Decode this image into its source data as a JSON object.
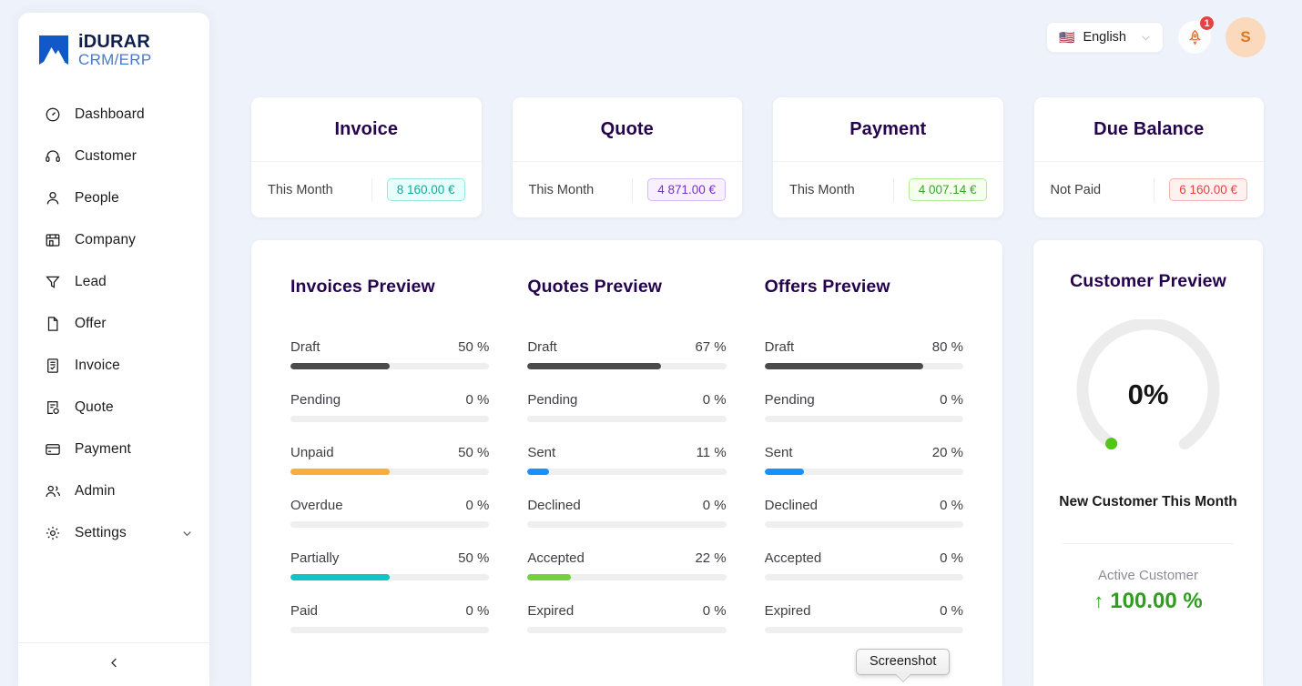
{
  "brand": {
    "name_line1": "iDURAR",
    "name_line2": "CRM/ERP",
    "logo_color": "#1158c9"
  },
  "sidebar": {
    "items": [
      {
        "label": "Dashboard",
        "icon": "dashboard-icon"
      },
      {
        "label": "Customer",
        "icon": "headset-icon"
      },
      {
        "label": "People",
        "icon": "person-icon"
      },
      {
        "label": "Company",
        "icon": "store-icon"
      },
      {
        "label": "Lead",
        "icon": "funnel-icon"
      },
      {
        "label": "Offer",
        "icon": "file-icon"
      },
      {
        "label": "Invoice",
        "icon": "invoice-icon"
      },
      {
        "label": "Quote",
        "icon": "quote-icon"
      },
      {
        "label": "Payment",
        "icon": "credit-card-icon"
      },
      {
        "label": "Admin",
        "icon": "admin-users-icon"
      },
      {
        "label": "Settings",
        "icon": "gear-icon",
        "has_caret": true
      }
    ],
    "collapse_icon": "chevron-left-icon"
  },
  "topbar": {
    "language": {
      "flag": "🇺🇸",
      "label": "English",
      "caret_icon": "chevron-down-icon"
    },
    "notification": {
      "icon": "rocket-icon",
      "badge": "1",
      "badge_color": "#e8423f"
    },
    "avatar": {
      "initial": "S",
      "bg": "#fbd9bc",
      "fg": "#e2751e"
    }
  },
  "stats": [
    {
      "title": "Invoice",
      "label": "This Month",
      "value": "8 160.00 €",
      "style": "pill-teal"
    },
    {
      "title": "Quote",
      "label": "This Month",
      "value": "4 871.00 €",
      "style": "pill-purple"
    },
    {
      "title": "Payment",
      "label": "This Month",
      "value": "4 007.14 €",
      "style": "pill-green"
    },
    {
      "title": "Due Balance",
      "label": "Not Paid",
      "value": "6 160.00 €",
      "style": "pill-red"
    }
  ],
  "previews": [
    {
      "title": "Invoices Preview",
      "rows": [
        {
          "name": "Draft",
          "pct": "50 %",
          "value": 50,
          "color": "#4b4b4b"
        },
        {
          "name": "Pending",
          "pct": "0 %",
          "value": 0,
          "color": "#4b4b4b"
        },
        {
          "name": "Unpaid",
          "pct": "50 %",
          "value": 50,
          "color": "#faad3f"
        },
        {
          "name": "Overdue",
          "pct": "0 %",
          "value": 0,
          "color": "#ff4d4f"
        },
        {
          "name": "Partially",
          "pct": "50 %",
          "value": 50,
          "color": "#13c2c2"
        },
        {
          "name": "Paid",
          "pct": "0 %",
          "value": 0,
          "color": "#52c41a"
        }
      ]
    },
    {
      "title": "Quotes Preview",
      "rows": [
        {
          "name": "Draft",
          "pct": "67 %",
          "value": 67,
          "color": "#4b4b4b"
        },
        {
          "name": "Pending",
          "pct": "0 %",
          "value": 0,
          "color": "#4b4b4b"
        },
        {
          "name": "Sent",
          "pct": "11 %",
          "value": 11,
          "color": "#1890ff"
        },
        {
          "name": "Declined",
          "pct": "0 %",
          "value": 0,
          "color": "#ff4d4f"
        },
        {
          "name": "Accepted",
          "pct": "22 %",
          "value": 22,
          "color": "#73d13d"
        },
        {
          "name": "Expired",
          "pct": "0 %",
          "value": 0,
          "color": "#bfbfbf"
        }
      ]
    },
    {
      "title": "Offers Preview",
      "rows": [
        {
          "name": "Draft",
          "pct": "80 %",
          "value": 80,
          "color": "#4b4b4b"
        },
        {
          "name": "Pending",
          "pct": "0 %",
          "value": 0,
          "color": "#4b4b4b"
        },
        {
          "name": "Sent",
          "pct": "20 %",
          "value": 20,
          "color": "#1890ff"
        },
        {
          "name": "Declined",
          "pct": "0 %",
          "value": 0,
          "color": "#ff4d4f"
        },
        {
          "name": "Accepted",
          "pct": "0 %",
          "value": 0,
          "color": "#73d13d"
        },
        {
          "name": "Expired",
          "pct": "0 %",
          "value": 0,
          "color": "#bfbfbf"
        }
      ]
    }
  ],
  "customer": {
    "title": "Customer Preview",
    "gauge_value": "0%",
    "gauge_percent": 0,
    "gauge_track_color": "#ececec",
    "subtitle": "New Customer This Month",
    "active_label": "Active Customer",
    "active_value": "100.00 %",
    "active_arrow": "↑",
    "active_color": "#2f9e1f"
  },
  "tooltip": {
    "text": "Screenshot"
  }
}
